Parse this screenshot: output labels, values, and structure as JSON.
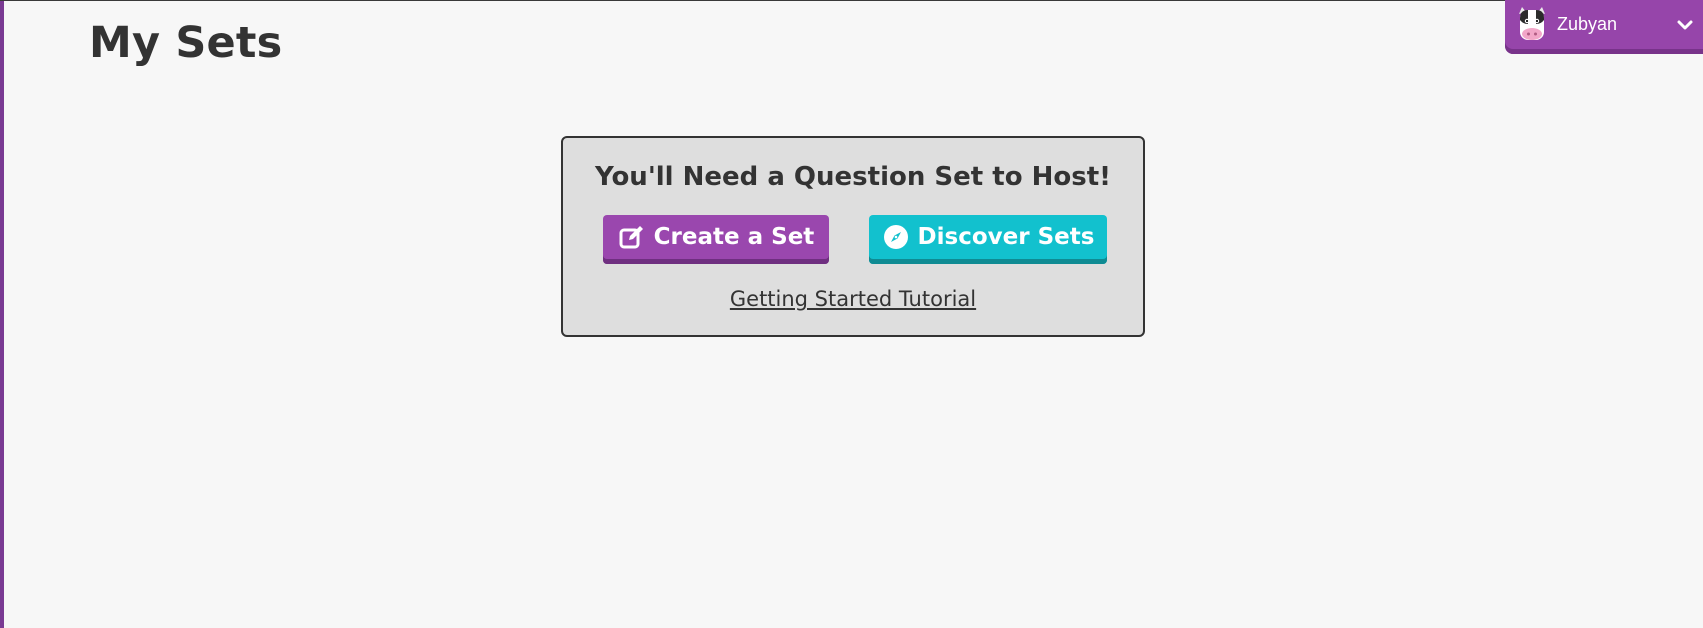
{
  "page": {
    "title": "My Sets"
  },
  "user_menu": {
    "username": "Zubyan",
    "avatar_icon": "cow-avatar-icon",
    "chevron_icon": "chevron-down-icon"
  },
  "empty_state": {
    "heading": "You'll Need a Question Set to Host!",
    "create_button": {
      "label": "Create a Set",
      "icon": "edit-icon"
    },
    "discover_button": {
      "label": "Discover Sets",
      "icon": "compass-icon"
    },
    "tutorial_link": "Getting Started Tutorial"
  },
  "colors": {
    "purple": "#9a47ae",
    "teal": "#12c1ce",
    "background": "#f7f7f7",
    "card": "#dedede"
  }
}
